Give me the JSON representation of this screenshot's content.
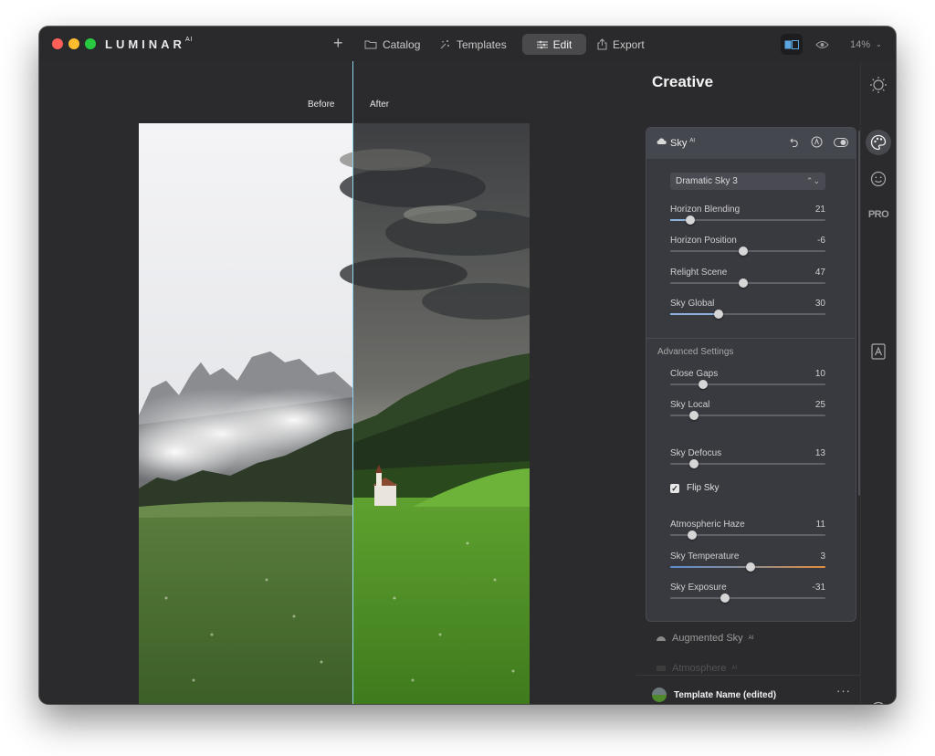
{
  "app": {
    "name": "LUMINAR",
    "name_suffix": "AI"
  },
  "toolbar": {
    "catalog": "Catalog",
    "templates": "Templates",
    "edit": "Edit",
    "export": "Export",
    "zoom": "14%"
  },
  "compare": {
    "before": "Before",
    "after": "After"
  },
  "panel": {
    "title": "Creative",
    "section": {
      "title": "Sky",
      "title_suffix": "AI",
      "preset": "Dramatic Sky 3",
      "sliders": [
        {
          "label": "Horizon Blending",
          "value": "21",
          "fraction": 0.13
        },
        {
          "label": "Horizon Position",
          "value": "-6",
          "fraction": 0.47
        },
        {
          "label": "Relight Scene",
          "value": "47",
          "fraction": 0.47
        },
        {
          "label": "Sky Global",
          "value": "30",
          "fraction": 0.31
        }
      ],
      "advanced_label": "Advanced Settings",
      "advanced_sliders": [
        {
          "label": "Close Gaps",
          "value": "10",
          "fraction": 0.21
        },
        {
          "label": "Sky Local",
          "value": "25",
          "fraction": 0.15
        },
        {
          "label": "Sky Defocus",
          "value": "13",
          "fraction": 0.15
        }
      ],
      "flip_sky": {
        "label": "Flip Sky",
        "checked": true
      },
      "haze_sliders": [
        {
          "label": "Atmospheric Haze",
          "value": "11",
          "fraction": 0.14
        },
        {
          "label": "Sky Temperature",
          "value": "3",
          "fraction": 0.52
        },
        {
          "label": "Sky Exposure",
          "value": "-31",
          "fraction": 0.35
        }
      ]
    },
    "next_sections": [
      {
        "title": "Augmented Sky",
        "suffix": "AI"
      },
      {
        "title": "Atmosphere",
        "suffix": "AI"
      }
    ],
    "template": {
      "name": "Template Name (edited)",
      "more": "···"
    }
  },
  "rail": {
    "pro": "PRO"
  }
}
